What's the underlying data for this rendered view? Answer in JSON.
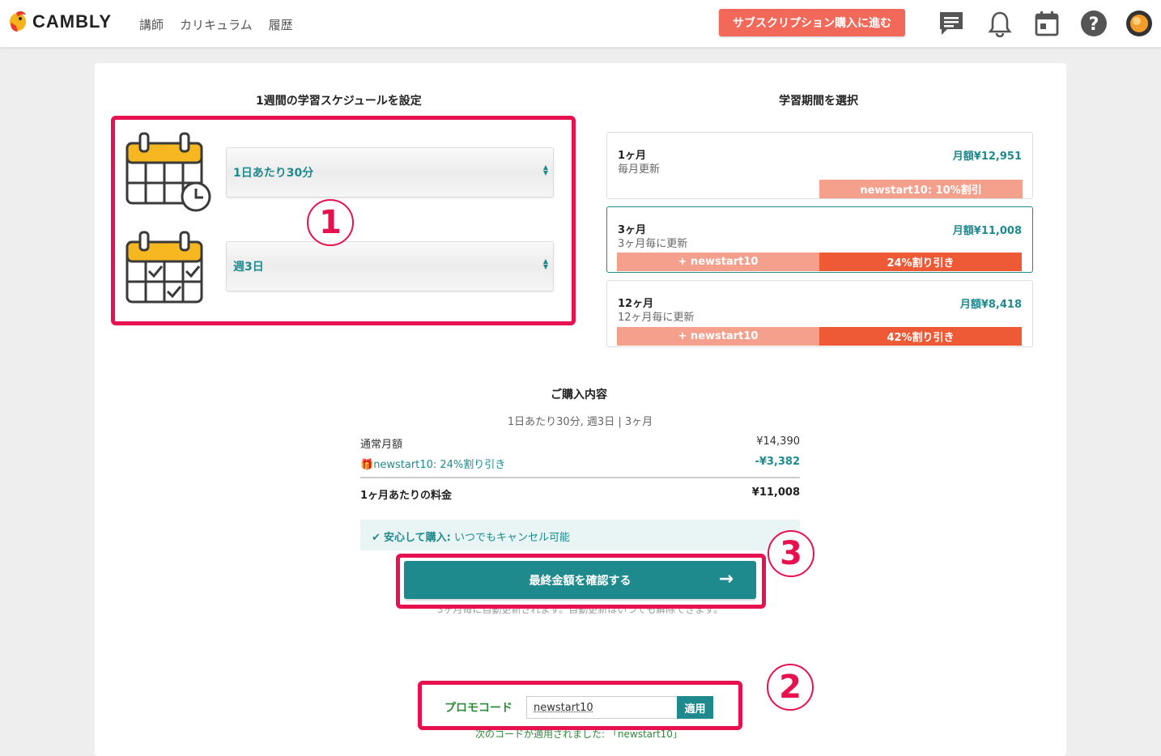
{
  "header": {
    "brand": "CAMBLY",
    "nav": [
      "講師",
      "カリキュラム",
      "履歴"
    ],
    "subscribe_button": "サブスクリプション購入に進む",
    "icons": [
      "chat-icon",
      "bell-icon",
      "calendar-icon",
      "help-icon",
      "avatar"
    ]
  },
  "schedule": {
    "title": "1週間の学習スケジュールを設定",
    "minutes_select": "1日あたり30分",
    "days_select": "週3日"
  },
  "period": {
    "title": "学習期間を選択",
    "plans": [
      {
        "name": "1ヶ月",
        "sub": "毎月更新",
        "price": "月額¥12,951",
        "tag_light": "newstart10: 10%割引",
        "tag_dark": ""
      },
      {
        "name": "3ヶ月",
        "sub": "3ヶ月毎に更新",
        "price": "月額¥11,008",
        "tag_light": "+ newstart10",
        "tag_dark": "24%割り引き"
      },
      {
        "name": "12ヶ月",
        "sub": "12ヶ月毎に更新",
        "price": "月額¥8,418",
        "tag_light": "+ newstart10",
        "tag_dark": "42%割り引き"
      }
    ]
  },
  "summary": {
    "title": "ご購入内容",
    "detail": "1日あたり30分, 週3日 | 3ヶ月",
    "regular_label": "通常月額",
    "regular_value": "¥14,390",
    "discount_label": "newstart10: 24%割り引き",
    "discount_value": "-¥3,382",
    "total_label": "1ヶ月あたりの料金",
    "total_value": "¥11,008",
    "safe_bold": "安心して購入:",
    "safe_text": " いつでもキャンセル可能",
    "cta": "最終金額を確認する",
    "note": "3ヶ月毎に自動更新されます。自動更新はいつでも解除できます。"
  },
  "promo": {
    "label": "プロモコード",
    "value": "newstart10",
    "apply": "適用",
    "applied": "次のコードが適用されました: 「newstart10」"
  },
  "annotations": [
    "1",
    "2",
    "3"
  ],
  "colors": {
    "teal": "#1f8a8e",
    "coral": "#f2695a",
    "annotation": "#e8114f"
  }
}
